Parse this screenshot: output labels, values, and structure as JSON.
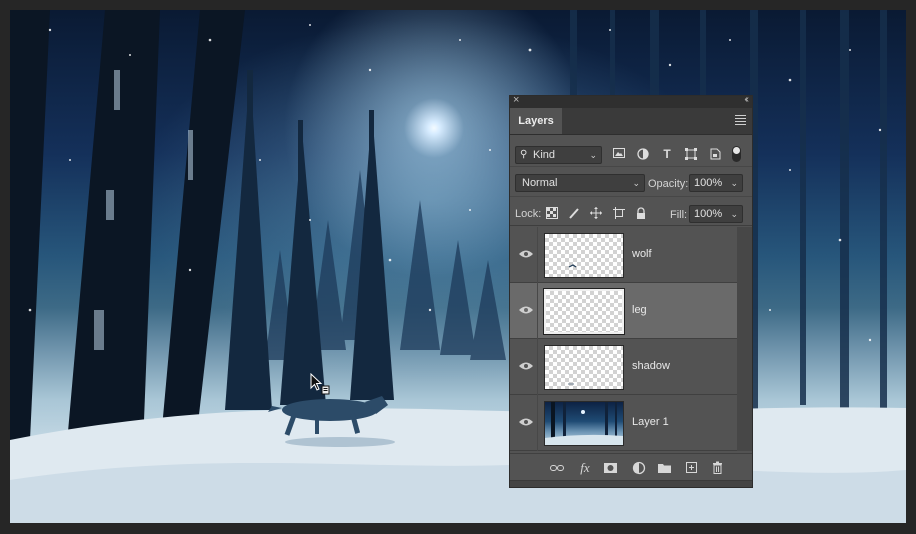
{
  "panel": {
    "close_glyph": "×",
    "collapse_glyph": "‹‹",
    "tab_label": "Layers",
    "filter": {
      "kind_label": "Kind",
      "icons": [
        "image-filter-icon",
        "adjustment-filter-icon",
        "type-filter-icon",
        "shape-filter-icon",
        "smart-object-filter-icon"
      ]
    },
    "blend_mode": "Normal",
    "opacity_label": "Opacity:",
    "opacity_value": "100%",
    "lock_label": "Lock:",
    "fill_label": "Fill:",
    "fill_value": "100%",
    "layers": [
      {
        "name": "wolf",
        "visible": true,
        "selected": false,
        "thumbnail": "transparent"
      },
      {
        "name": "leg",
        "visible": true,
        "selected": true,
        "thumbnail": "transparent"
      },
      {
        "name": "shadow",
        "visible": true,
        "selected": false,
        "thumbnail": "transparent"
      },
      {
        "name": "Layer 1",
        "visible": true,
        "selected": false,
        "thumbnail": "photo"
      }
    ],
    "footer_icons": [
      "link-layers-icon",
      "fx-icon",
      "mask-icon",
      "adjustment-layer-icon",
      "group-folder-icon",
      "new-layer-icon",
      "trash-icon"
    ]
  },
  "colors": {
    "workspace_bg": "#262626",
    "panel_bg": "#535353",
    "selected_row": "#6a6a6a",
    "sky_dark": "#0a1a33",
    "snow": "#e4eef4"
  }
}
